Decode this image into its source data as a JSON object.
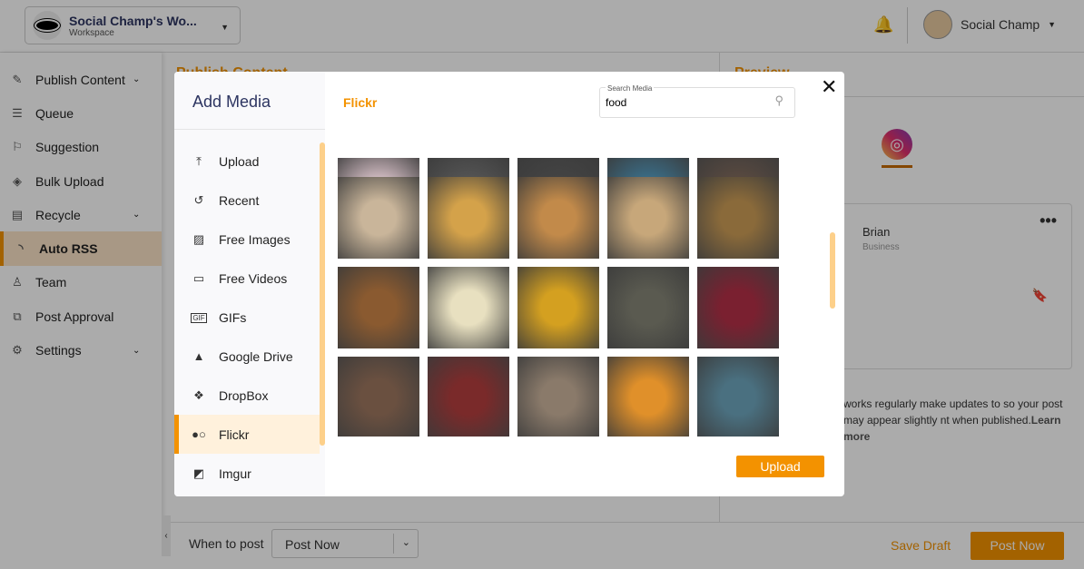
{
  "header": {
    "workspace_name": "Social Champ's Wo...",
    "workspace_sub": "Workspace",
    "user_name": "Social Champ"
  },
  "sidebar": {
    "items": [
      {
        "label": "Publish Content",
        "icon": "pen-icon",
        "chevron": true
      },
      {
        "label": "Queue",
        "icon": "list-icon"
      },
      {
        "label": "Suggestion",
        "icon": "bookmark-icon"
      },
      {
        "label": "Bulk Upload",
        "icon": "layers-icon"
      },
      {
        "label": "Recycle",
        "icon": "archive-icon",
        "chevron": true
      },
      {
        "label": "Auto RSS",
        "icon": "rss-icon",
        "active": true
      },
      {
        "label": "Team",
        "icon": "user-icon"
      },
      {
        "label": "Post Approval",
        "icon": "approval-icon"
      },
      {
        "label": "Settings",
        "icon": "gear-icon",
        "chevron": true
      }
    ]
  },
  "main": {
    "title": "Publish Content"
  },
  "preview": {
    "title": "Preview",
    "profile_name": "Brian",
    "profile_type": "Business",
    "note": "works regularly make updates to so your post may appear slightly nt when published.",
    "learn_more": "Learn more"
  },
  "bottom": {
    "when_label": "When to post",
    "when_value": "Post Now",
    "save_draft": "Save Draft",
    "post_now": "Post Now"
  },
  "modal": {
    "title": "Add Media",
    "source": "Flickr",
    "search_label": "Search Media",
    "search_value": "food",
    "upload": "Upload",
    "nav": [
      {
        "label": "Upload",
        "icon": "upload-icon"
      },
      {
        "label": "Recent",
        "icon": "history-icon"
      },
      {
        "label": "Free Images",
        "icon": "image-icon"
      },
      {
        "label": "Free Videos",
        "icon": "video-icon"
      },
      {
        "label": "GIFs",
        "icon": "gif-icon"
      },
      {
        "label": "Google Drive",
        "icon": "google-drive-icon"
      },
      {
        "label": "DropBox",
        "icon": "dropbox-icon"
      },
      {
        "label": "Flickr",
        "icon": "flickr-icon",
        "active": true
      },
      {
        "label": "Imgur",
        "icon": "imgur-icon"
      }
    ]
  },
  "colors": {
    "accent": "#f39200",
    "navy": "#2d3561"
  }
}
